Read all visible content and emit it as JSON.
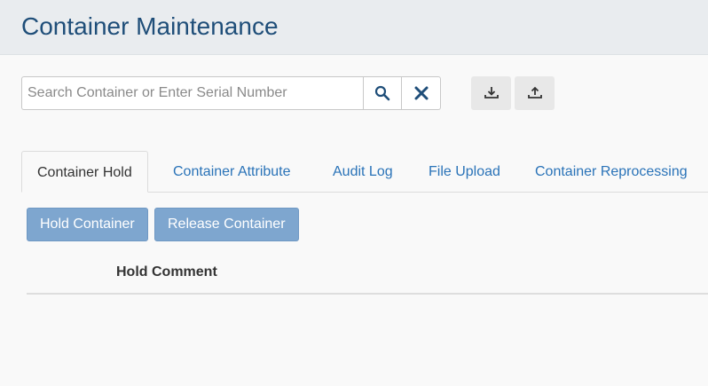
{
  "header": {
    "title": "Container Maintenance"
  },
  "search": {
    "placeholder": "Search Container or Enter Serial Number",
    "value": "",
    "search_icon": "search-icon",
    "clear_icon": "close-icon"
  },
  "toolbar": {
    "download_icon": "download-icon",
    "upload_icon": "upload-icon"
  },
  "tabs": [
    {
      "label": "Container Hold",
      "active": true
    },
    {
      "label": "Container Attribute",
      "active": false
    },
    {
      "label": "Audit Log",
      "active": false
    },
    {
      "label": "File Upload",
      "active": false
    },
    {
      "label": "Container Reprocessing",
      "active": false
    }
  ],
  "actions": {
    "hold_label": "Hold Container",
    "release_label": "Release Container"
  },
  "table": {
    "columns": [
      "Hold Comment"
    ]
  },
  "colors": {
    "title": "#1f4e79",
    "link": "#2a73b8",
    "button": "#7ea6cf",
    "header_bg": "#e9ecef"
  }
}
